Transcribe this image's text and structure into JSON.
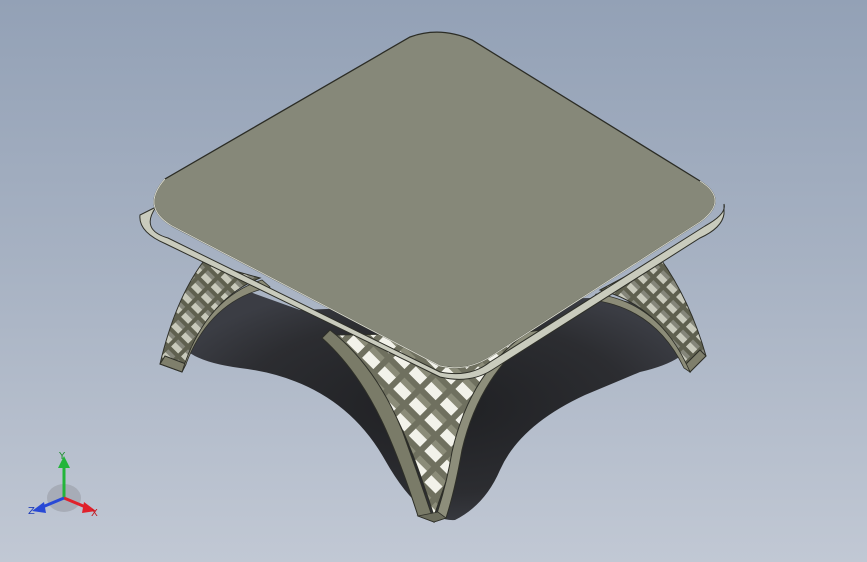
{
  "scene": {
    "model": "table",
    "view": "isometric",
    "colors": {
      "background_top": "#93a1b6",
      "background_bottom": "#c1c8d4",
      "tabletop": "#868879",
      "tabletop_edge": "#c9cbbd",
      "leg_frame": "#7f7f6c",
      "shadow": "#2a2b2e"
    }
  },
  "triad": {
    "x_label": "X",
    "y_label": "Y",
    "z_label": "Z",
    "x_color": "#e0212b",
    "y_color": "#23b53a",
    "z_color": "#2849d6"
  }
}
